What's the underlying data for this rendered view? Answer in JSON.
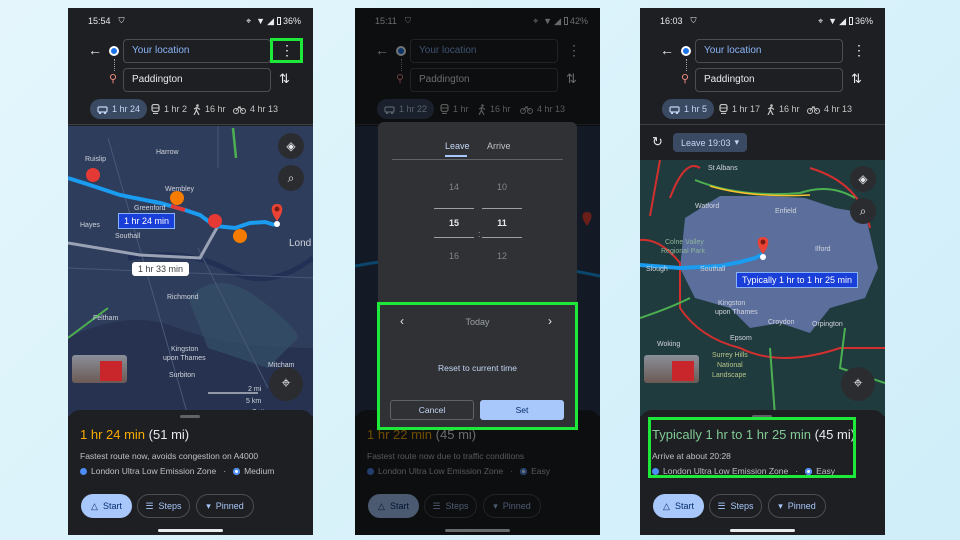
{
  "colors": {
    "accent": "#a8c7fa",
    "highlight": "#1ee83a",
    "route": "#1a9cf0",
    "orange_time": "#f9ab00",
    "green_time": "#81c995"
  },
  "phones": [
    {
      "time": "15:54",
      "battery": "36%",
      "origin": "Your location",
      "destination": "Paddington",
      "modes": [
        {
          "icon": "car-icon",
          "label": "1 hr 24"
        },
        {
          "icon": "train-icon",
          "label": "1 hr 2"
        },
        {
          "icon": "walk-icon",
          "label": "16 hr"
        },
        {
          "icon": "bike-icon",
          "label": "4 hr 13"
        }
      ],
      "map": {
        "labels": [
          "Harrow",
          "Ruislip",
          "Wembley",
          "Greenford",
          "Hayes",
          "Southall",
          "Lond",
          "Richmond",
          "Feltham",
          "Kingston",
          "upon Thames",
          "Mitcham",
          "Surbiton",
          "Sutton",
          "2 mi",
          "5 km"
        ],
        "route_label": "1 hr 24 min",
        "alt_route_label": "1 hr 33 min"
      },
      "sheet": {
        "duration": "1 hr 24 min",
        "distance": "(51 mi)",
        "description": "Fastest route now, avoids congestion on A4000",
        "zone": "London Ultra Low Emission Zone",
        "difficulty": "Medium"
      },
      "buttons": {
        "start": "Start",
        "steps": "Steps",
        "pinned": "Pinned"
      }
    },
    {
      "time": "15:11",
      "battery": "42%",
      "origin": "Your location",
      "destination": "Paddington",
      "modes": [
        {
          "icon": "car-icon",
          "label": "1 hr 22"
        },
        {
          "icon": "train-icon",
          "label": "1 hr"
        },
        {
          "icon": "walk-icon",
          "label": "16 hr"
        },
        {
          "icon": "bike-icon",
          "label": "4 hr 13"
        }
      ],
      "sheet": {
        "duration": "1 hr 22 min",
        "distance": "(45 mi)",
        "description": "Fastest route now due to traffic conditions",
        "zone": "London Ultra Low Emission Zone",
        "difficulty": "Easy"
      },
      "buttons": {
        "start": "Start",
        "steps": "Steps",
        "pinned": "Pinned"
      },
      "dialog": {
        "tabs": [
          "Leave",
          "Arrive"
        ],
        "active_tab": "Leave",
        "hours": [
          "14",
          "15",
          "16"
        ],
        "minutes": [
          "10",
          "11",
          "12"
        ],
        "separator": ":",
        "day": "Today",
        "reset": "Reset to current time",
        "cancel": "Cancel",
        "set": "Set"
      }
    },
    {
      "time": "16:03",
      "battery": "36%",
      "origin": "Your location",
      "destination": "Paddington",
      "modes": [
        {
          "icon": "car-icon",
          "label": "1 hr 5"
        },
        {
          "icon": "train-icon",
          "label": "1 hr 17"
        },
        {
          "icon": "walk-icon",
          "label": "16 hr"
        },
        {
          "icon": "bike-icon",
          "label": "4 hr 13"
        }
      ],
      "leave_chip": "Leave 19:03",
      "map": {
        "labels": [
          "St Albans",
          "Watford",
          "Enfield",
          "Colne Valley",
          "Regional Park",
          "Ilford",
          "Slough",
          "Southall",
          "Kingston",
          "upon Thames",
          "Croydon",
          "Orpington",
          "Woking",
          "Epsom",
          "Surrey Hills",
          "National",
          "Landscape"
        ],
        "route_label": "Typically 1 hr to 1 hr 25 min"
      },
      "sheet": {
        "duration": "Typically 1 hr to 1 hr 25 min",
        "distance": "(45 mi)",
        "description": "Arrive at about 20:28",
        "zone": "London Ultra Low Emission Zone",
        "difficulty": "Easy"
      },
      "buttons": {
        "start": "Start",
        "steps": "Steps",
        "pinned": "Pinned"
      }
    }
  ]
}
